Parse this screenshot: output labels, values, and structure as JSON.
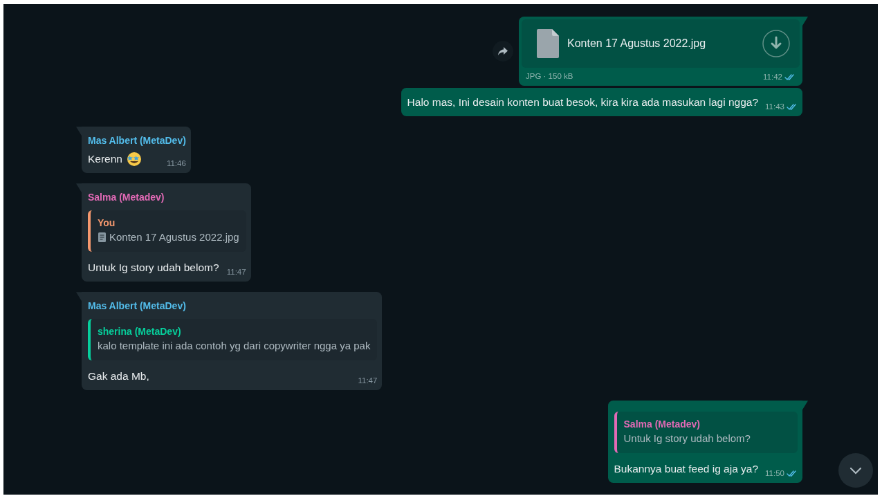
{
  "messages": [
    {
      "kind": "file",
      "outgoing": true,
      "tail": true,
      "forward_button": true,
      "file_name": "Konten 17 Agustus 2022.jpg",
      "file_meta": "JPG · 150 kB",
      "time": "11:42",
      "read": true
    },
    {
      "kind": "text",
      "outgoing": true,
      "tail": false,
      "text": "Halo mas, Ini desain konten buat besok, kira kira ada masukan lagi ngga?",
      "time": "11:43",
      "read": true
    },
    {
      "kind": "text",
      "outgoing": false,
      "tail": true,
      "sender": {
        "name": "Mas Albert (MetaDev)",
        "color": "#53bdeb"
      },
      "text": "Kerenn",
      "has_emoji": true,
      "time": "11:46"
    },
    {
      "kind": "text",
      "outgoing": false,
      "tail": true,
      "sender": {
        "name": "Salma (Metadev)",
        "color": "#e26ab6"
      },
      "quote": {
        "kind": "document",
        "author": "You",
        "color": "#f5986e",
        "text": "Konten 17 Agustus 2022.jpg"
      },
      "text": "Untuk Ig story udah belom?",
      "time": "11:47"
    },
    {
      "kind": "text",
      "outgoing": false,
      "tail": true,
      "sender": {
        "name": "Mas Albert (MetaDev)",
        "color": "#53bdeb"
      },
      "quote": {
        "kind": "text",
        "author": "sherina (MetaDev)",
        "color": "#06cf9c",
        "text": "kalo template ini ada contoh yg dari copywriter ngga ya pak"
      },
      "text": "Gak ada Mb,",
      "time": "11:47"
    },
    {
      "kind": "text",
      "outgoing": true,
      "tail": true,
      "quote": {
        "kind": "text",
        "author": "Salma (Metadev)",
        "color": "#e26ab6",
        "text": "Untuk Ig story udah belom?"
      },
      "text": "Bukannya buat feed ig aja ya?",
      "time": "11:50",
      "read": true
    }
  ],
  "scroll_down_button": true
}
